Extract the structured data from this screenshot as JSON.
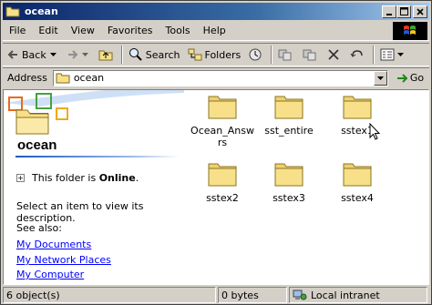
{
  "window": {
    "title": "ocean"
  },
  "menu": [
    "File",
    "Edit",
    "View",
    "Favorites",
    "Tools",
    "Help"
  ],
  "toolbar": {
    "back_label": "Back",
    "search_label": "Search",
    "folders_label": "Folders"
  },
  "address": {
    "label": "Address",
    "value": "ocean",
    "go_label": "Go"
  },
  "sidebar": {
    "folder_name": "ocean",
    "online_prefix": "This folder is ",
    "online_status": "Online",
    "online_suffix": ".",
    "description": "Select an item to view its description.",
    "see_also_label": "See also:",
    "links": [
      "My Documents",
      "My Network Places",
      "My Computer"
    ]
  },
  "files": [
    {
      "name": "Ocean_Answers",
      "line1": "Ocean_Answ",
      "line2": "rs"
    },
    {
      "name": "sst_entire",
      "line1": "sst_entire",
      "line2": ""
    },
    {
      "name": "sstex1",
      "line1": "sstex1",
      "line2": ""
    },
    {
      "name": "sstex2",
      "line1": "sstex2",
      "line2": ""
    },
    {
      "name": "sstex3",
      "line1": "sstex3",
      "line2": ""
    },
    {
      "name": "sstex4",
      "line1": "sstex4",
      "line2": ""
    }
  ],
  "status": {
    "objects": "6 object(s)",
    "size": "0 bytes",
    "zone": "Local intranet"
  },
  "colors": {
    "title_start": "#0a246a",
    "title_end": "#a6caf0",
    "folder": "#f8e08a",
    "link": "#0000ff"
  }
}
